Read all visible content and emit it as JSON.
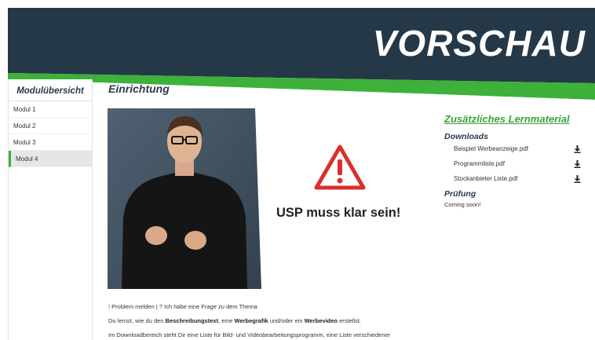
{
  "banner": {
    "title": "VORSCHAU"
  },
  "sidebar": {
    "title": "Modulübersicht",
    "items": [
      {
        "label": "Modul 1"
      },
      {
        "label": "Modul 2"
      },
      {
        "label": "Modul 3"
      },
      {
        "label": "Modul 4"
      }
    ]
  },
  "main": {
    "title": "Einrichtung",
    "usp_text": "USP muss klar sein!",
    "problem_link": "! Problem melden",
    "separator": "|",
    "question_link": "? Ich habe eine Frage zu dem Thema",
    "desc": {
      "part1": "Du lernst, wie du den ",
      "b1": "Beschreibungstext",
      "part2": ", eine ",
      "b2": "Werbegrafik",
      "part3": " und/oder ein ",
      "b3": "Werbevideo",
      "part4": " erstellst."
    },
    "download_text": "Im Downloadbereich steht Dir eine Liste für Bild- und Videobearbeitungsprogramm, eine Liste verschiedener"
  },
  "right": {
    "title": "Zusätzliches Lernmaterial",
    "downloads_title": "Downloads",
    "downloads": [
      {
        "label": "Beispiel Werbeanzeige.pdf"
      },
      {
        "label": "Programmliste.pdf"
      },
      {
        "label": "Stockanbieter Liste.pdf"
      }
    ],
    "pruefung_title": "Prüfung",
    "pruefung_text": "Coming soon!"
  },
  "colors": {
    "banner": "#253847",
    "accent": "#3db13a",
    "warning": "#d9302c"
  },
  "icons": [
    "download-icon",
    "warning-triangle-icon"
  ]
}
